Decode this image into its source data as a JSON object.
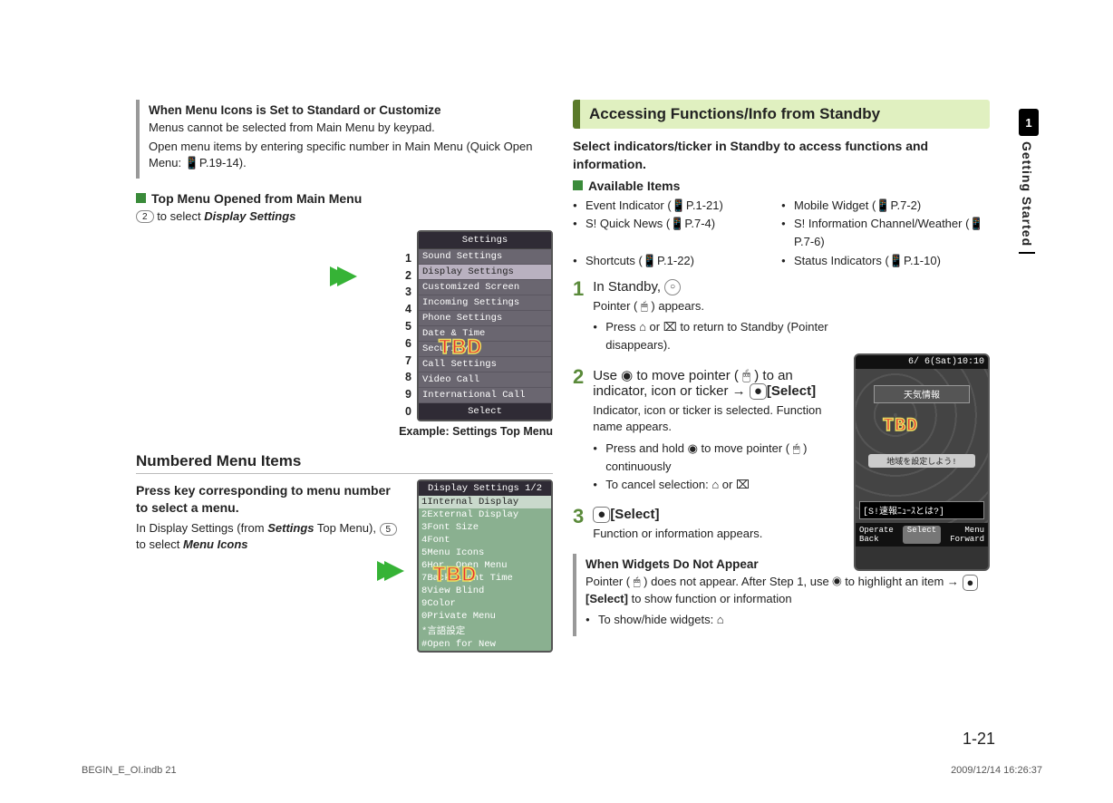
{
  "left": {
    "note": {
      "title": "When Menu Icons is Set to Standard or Customize",
      "l1": "Menus cannot be selected from Main Menu by keypad.",
      "l2": "Open menu items by entering specific number in Main Menu (Quick Open Menu: 📱P.19-14)."
    },
    "top_menu_h": "Top Menu Opened from Main Menu",
    "top_menu_body_a": "to select",
    "top_menu_body_b": "Display Settings",
    "key2": "2",
    "settings_title": "Settings",
    "settings_items": [
      "Sound Settings",
      "Display Settings",
      "Customized Screen",
      "Incoming Settings",
      "Phone Settings",
      "Date & Time",
      "Security",
      "Call Settings",
      "Video Call",
      "International Call"
    ],
    "settings_select": "Select",
    "caption1": "Example: Settings Top Menu",
    "numbers": [
      "1",
      "2",
      "3",
      "4",
      "5",
      "6",
      "7",
      "8",
      "9",
      "0"
    ],
    "tbd": "TBD",
    "section_numbered": "Numbered Menu Items",
    "press_h": "Press key corresponding to menu number to select a menu.",
    "press_b1": "In Display Settings (from ",
    "press_b1b": "Settings",
    "press_b2": " Top Menu), ",
    "key5": "5",
    "press_b3": " to select ",
    "press_b3b": "Menu Icons",
    "ds_title": "Display Settings 1/2",
    "ds_items": [
      "Internal Display",
      "External Display",
      "Font Size",
      "Font",
      "Menu Icons",
      "Hor. Open Menu",
      "Back Light Time",
      "View Blind",
      "Color",
      "Private Menu",
      "言語設定",
      "Open for New"
    ]
  },
  "right": {
    "header": "Accessing Functions/Info from Standby",
    "lead": "Select indicators/ticker in Standby to access functions and information.",
    "avail_h": "Available Items",
    "avail": [
      "Event Indicator (📱P.1-21)",
      "Mobile Widget (📱P.7-2)",
      "S! Quick News (📱P.7-4)",
      "S! Information Channel/Weather (📱P.7-6)",
      "Shortcuts (📱P.1-22)",
      "Status Indicators (📱P.1-10)"
    ],
    "s1": {
      "lead_a": "In Standby, ",
      "l1": "Pointer ( 🖱 ) appears.",
      "b1": "Press ⌂ or ⌧ to return to Standby (Pointer disappears)."
    },
    "s2": {
      "lead": "Use ◉ to move pointer ( 🖱 ) to an indicator, icon or ticker → ",
      "select": "[Select]",
      "l1": "Indicator, icon or ticker is selected. Function name appears.",
      "b1": "Press and hold ◉ to move pointer ( 🖱 ) continuously",
      "b2": "To cancel selection: ⌂ or ⌧"
    },
    "s3": {
      "select": "[Select]",
      "l1": "Function or information appears."
    },
    "widgets": {
      "title": "When Widgets Do Not Appear",
      "l1": "Pointer ( 🖱 ) does not appear. After Step 1, use ◉ to highlight an item → ",
      "select": "[Select]",
      "l1b": " to show function or information",
      "b1": "To show/hide widgets: ⌂"
    },
    "phone3": {
      "date": "6/ 6(Sat)10:10",
      "weather": "天気情報",
      "region": "地域を設定しよう!",
      "ticker": "[S!速報ﾆｭｰｽとは?]",
      "soft": [
        "Operate\nBack",
        "Select",
        "Menu\nForward"
      ]
    }
  },
  "side": {
    "num": "1",
    "label": "Getting Started"
  },
  "page_num": "1-21",
  "footer": {
    "left": "BEGIN_E_OI.indb   21",
    "right": "2009/12/14   16:26:37"
  }
}
